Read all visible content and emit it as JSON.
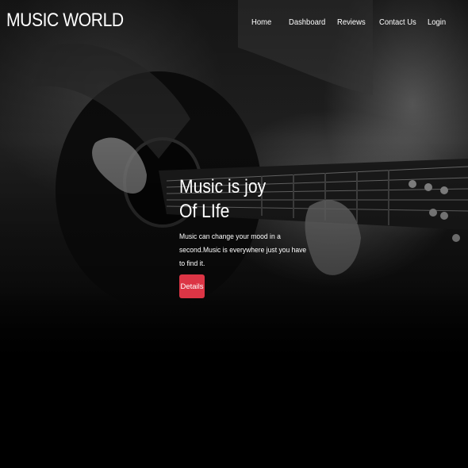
{
  "navbar": {
    "brand": "MUSIC WORLD",
    "links": [
      {
        "label": "Home"
      },
      {
        "label": "Dashboard"
      },
      {
        "label": "Reviews"
      },
      {
        "label": "Contact Us"
      },
      {
        "label": "Login"
      }
    ]
  },
  "hero": {
    "title_line1": "Music is joy",
    "title_line2": "Of LIfe",
    "text": "Music can change your mood in a second.Music is everywhere just you have to find it.",
    "button_label": "Details"
  },
  "colors": {
    "background": "#000000",
    "button": "#dc3545",
    "text": "#ffffff"
  }
}
